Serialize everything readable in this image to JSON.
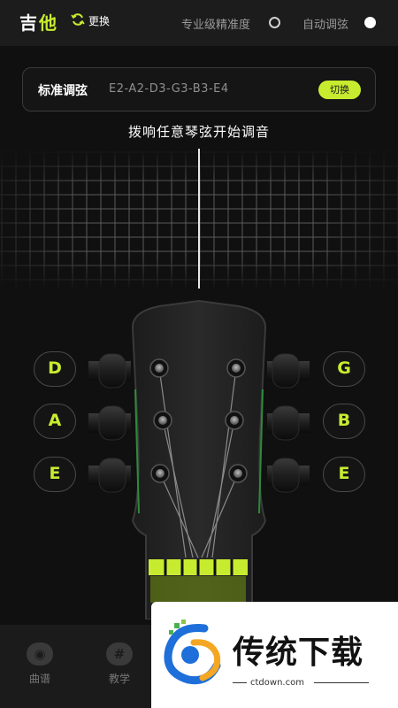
{
  "header": {
    "title_part1": "吉",
    "title_part2": "他",
    "switch_label": "更换",
    "pro_precision_label": "专业级精准度",
    "auto_tune_label": "自动调弦"
  },
  "tuning": {
    "name": "标准调弦",
    "notes": "E2-A2-D3-G3-B3-E4",
    "switch_button": "切换"
  },
  "hint": "拨响任意琴弦开始调音",
  "strings_left": [
    "D",
    "A",
    "E"
  ],
  "strings_right": [
    "G",
    "B",
    "E"
  ],
  "bottom_nav": [
    {
      "label": "曲谱",
      "icon": "record-icon"
    },
    {
      "label": "教学",
      "icon": "hash-icon"
    }
  ],
  "watermark": {
    "text": "传统下载",
    "url": "ctdown.com"
  },
  "colors": {
    "accent": "#c7ec2f",
    "background": "#101010"
  }
}
